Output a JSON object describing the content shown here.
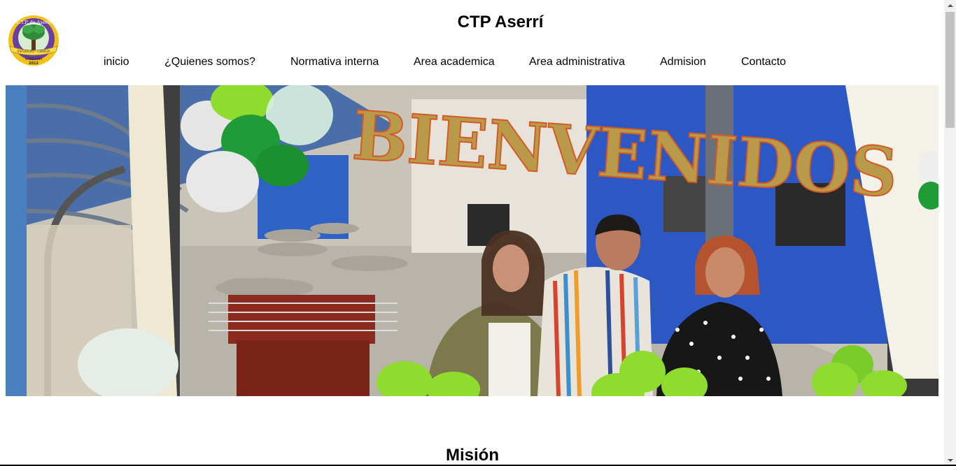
{
  "header": {
    "title": "CTP Aserrí",
    "logo": {
      "top_text": "C.T.P. de Aserrí",
      "ribbon_text": "ESFUERZO · CIENCIA",
      "bottom_text": "SABIDURÍA",
      "year": "2012"
    }
  },
  "nav": {
    "items": [
      {
        "label": "inicio"
      },
      {
        "label": "¿Quienes somos?"
      },
      {
        "label": "Normativa interna"
      },
      {
        "label": "Area academica"
      },
      {
        "label": "Area administrativa"
      },
      {
        "label": "Admision"
      },
      {
        "label": "Contacto"
      }
    ]
  },
  "hero": {
    "banner_text": "BIENVENIDOS"
  },
  "sections": {
    "mision_title": "Misión"
  },
  "colors": {
    "logo_purple": "#6b3fa0",
    "logo_yellow": "#f2c21b",
    "balloon_green": "#2fae3c",
    "balloon_lime": "#8fdc2e",
    "wall_blue": "#2d58c4",
    "banner_gold": "#b89a4a"
  }
}
